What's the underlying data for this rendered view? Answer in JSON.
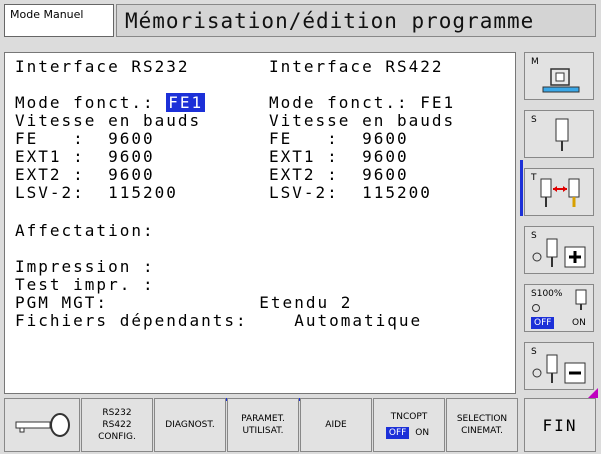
{
  "header": {
    "mode_tab": "Mode Manuel",
    "title": "Mémorisation/édition programme"
  },
  "screen": {
    "left": {
      "header": "Interface RS232",
      "mode_label": "Mode fonct.: ",
      "mode_value": "FE1",
      "baud_title": "Vitesse en bauds",
      "fe": "FE   :  9600",
      "ext1": "EXT1 :  9600",
      "ext2": "EXT2 :  9600",
      "lsv2": "LSV-2:  115200"
    },
    "right": {
      "header": "Interface RS422",
      "mode": "Mode fonct.: FE1",
      "baud_title": "Vitesse en bauds",
      "fe": "FE   :  9600",
      "ext1": "EXT1 :  9600",
      "ext2": "EXT2 :  9600",
      "lsv2": "LSV-2:  115200"
    },
    "affectation": "Affectation:",
    "impression": "Impression :",
    "test_impr": "Test impr. :",
    "pgm_mgt": "PGM MGT:             Etendu 2",
    "fichiers": "Fichiers dépendants:    Automatique"
  },
  "sidebar": {
    "btn1_label": "M",
    "btn2_label": "S",
    "btn3_label": "T",
    "btn4_label": "S",
    "btn5_label": "S100%",
    "btn5_off": "OFF",
    "btn5_on": "ON",
    "btn6_label": "S"
  },
  "bottom": {
    "rs232_line1": "RS232",
    "rs232_line2": "RS422",
    "rs232_line3": "CONFIG.",
    "diagnost": "DIAGNOST.",
    "paramet_line1": "PARAMET.",
    "paramet_line2": "UTILISAT.",
    "aide": "AIDE",
    "tncopt": "TNCOPT",
    "tncopt_off": "OFF",
    "tncopt_on": "ON",
    "selection_line1": "SELECTION",
    "selection_line2": "CINEMAT.",
    "fin": "FIN"
  },
  "colors": {
    "accent": "#1c30d8",
    "background": "#dcdcdc",
    "screen": "#ffffff"
  }
}
